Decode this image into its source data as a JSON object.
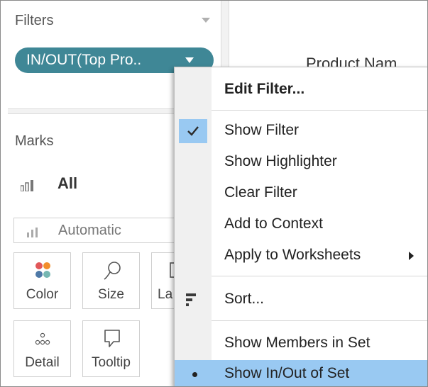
{
  "filters": {
    "title": "Filters",
    "pill_label": "IN/OUT(Top Pro.."
  },
  "view": {
    "column_header": "Product Nam"
  },
  "marks": {
    "title": "Marks",
    "all_label": "All",
    "mark_type": "Automatic",
    "cards": [
      {
        "label": "Color",
        "icon": "color-dots-icon"
      },
      {
        "label": "Size",
        "icon": "size-lasso-icon"
      },
      {
        "label": "La",
        "icon": "label-icon"
      },
      {
        "label": "Detail",
        "icon": "detail-dots-icon"
      },
      {
        "label": "Tooltip",
        "icon": "tooltip-bubble-icon"
      }
    ]
  },
  "menu": {
    "items": [
      {
        "label": "Edit Filter..."
      },
      {
        "label": "Show Filter",
        "checked": true
      },
      {
        "label": "Show Highlighter"
      },
      {
        "label": "Clear Filter"
      },
      {
        "label": "Add to Context"
      },
      {
        "label": "Apply to Worksheets",
        "submenu": true
      },
      {
        "label": "Sort...",
        "icon": "sort-icon"
      },
      {
        "label": "Show Members in Set"
      },
      {
        "label": "Show In/Out of Set",
        "selected": true
      }
    ]
  },
  "colors": {
    "pill": "#3f8796",
    "menu_highlight": "#99c9f2",
    "color_dots": [
      "#e15759",
      "#f28e2b",
      "#4e79a7",
      "#76b7b2"
    ]
  }
}
